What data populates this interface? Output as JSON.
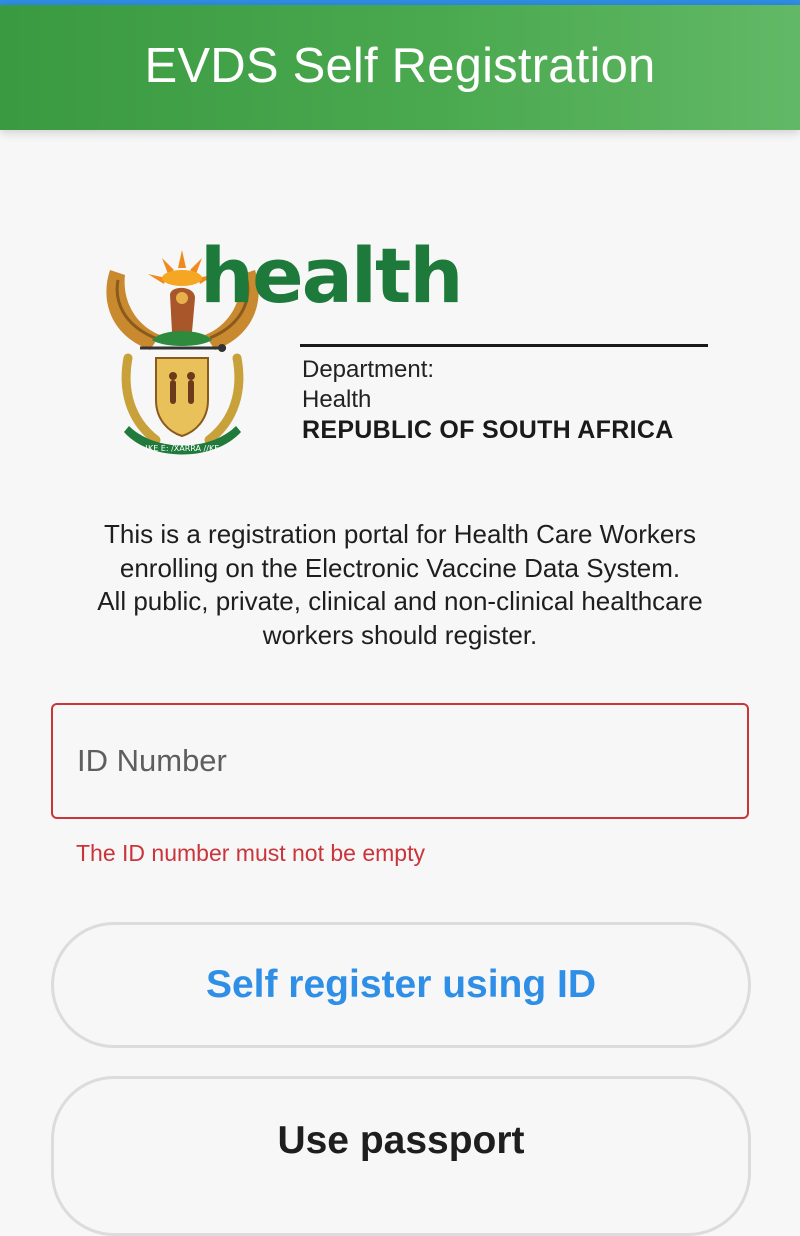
{
  "header": {
    "title": "EVDS Self Registration"
  },
  "logo": {
    "emblem_icon": "south-africa-coat-of-arms-icon",
    "motto": "!KE E: /XARRA //KE",
    "wordmark": "health",
    "department_line1": "Department:",
    "department_line2": "Health",
    "country": "REPUBLIC OF SOUTH AFRICA"
  },
  "intro": {
    "line1": "This is a registration portal for Health Care Workers",
    "line2": "enrolling on the Electronic Vaccine Data System.",
    "line3": "All public, private, clinical and non-clinical healthcare",
    "line4": "workers should register."
  },
  "form": {
    "id_field_placeholder": "ID Number",
    "id_field_value": "",
    "error_message": "The ID number must not be empty",
    "primary_button_label": "Self register using ID",
    "secondary_button_label": "Use passport"
  },
  "colors": {
    "header_green": "#4aa94f",
    "brand_green": "#1d7a3a",
    "accent_blue": "#2f8fe6",
    "error_red": "#c9353b"
  }
}
